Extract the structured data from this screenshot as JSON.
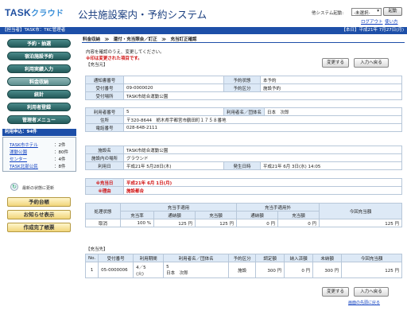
{
  "header": {
    "logo_text": "TASK",
    "logo_sub": "クラウド",
    "app_title": "公共施設案内・予約システム",
    "sys_label": "他システム起動:",
    "sys_select_value": "-未選択-",
    "start_button": "起動",
    "logout_link": "ログアウト",
    "help_link": "使い方"
  },
  "topbar": {
    "left": "【担当者】TASK市：TKC管理者",
    "right": "【本日】平成21年 7月27日(月)"
  },
  "sidebar": {
    "nav": [
      {
        "label": "予約・抽選"
      },
      {
        "label": "宿泊施設予約"
      },
      {
        "label": "利用実績入力"
      },
      {
        "label": "料金収納"
      },
      {
        "label": "統計"
      },
      {
        "label": "利用者登録"
      },
      {
        "label": "管理者メニュー"
      }
    ],
    "box_title": "利用申込：94件",
    "box_rows": [
      {
        "name": "TASK市ホテル",
        "count": "：2件"
      },
      {
        "name": "運動公園",
        "count": "：80件"
      },
      {
        "name": "センター",
        "count": "：4件"
      },
      {
        "name": "TASK北部公民",
        "count": "：8件"
      }
    ],
    "refresh_text": "最新の状態に更新",
    "btn_daicho": "予約台帳",
    "btn_oshirase": "お知らせ表示",
    "btn_kanryo": "作成完了帳票"
  },
  "main": {
    "breadcrumb": "料金収納　≫　還付・充当照会／訂正　≫　充当訂正確認",
    "msg1": "内容を確認のうえ、変更してください。",
    "msg2": "※印は変更された項目です。",
    "sec1_head": "【充当元】",
    "btn_change": "変更する",
    "btn_back": "入力へ戻る",
    "receipt": {
      "notice_no_label": "通知書番号",
      "notice_no_value": "",
      "status_label": "予約状態",
      "status_value": "本予約",
      "uketsuke_no_label": "受付番号",
      "uketsuke_no_value": "09-0000020",
      "yoyaku_kubun_label": "予約区分",
      "yoyaku_kubun_value": "施設予約",
      "uketsuke_basho_label": "受付場所",
      "uketsuke_basho_value": "TASK市総合運動公園"
    },
    "user": {
      "user_no_label": "利用者番号",
      "user_no_value": "5",
      "user_name_label": "利用者名／団体名",
      "user_name_value": "日本　次郎",
      "address_label": "住所",
      "address_value": "〒320-8644　栃木県宇都宮市鶴田町１７５８番地",
      "tel_label": "電話番号",
      "tel_value": "028-648-2111"
    },
    "facility": {
      "shisetsu_label": "施設名",
      "shisetsu_value": "TASK市総合運動公園",
      "naiyou_label": "施設内の場所",
      "naiyou_value": "グラウンド",
      "riyoubi_label": "利用日",
      "riyoubi_value": "平成21年 5月28日(木)",
      "hassei_label": "発生日時",
      "hassei_value": "平成21年 6月 3日(水) 14:05"
    },
    "juto": {
      "date_label": "※充当日",
      "date_value": "平成21年 6月 1日(月)",
      "reason_label": "※理由",
      "reason_value": "施設都合"
    },
    "summary": {
      "h_status": "処理状態",
      "h_applied": "充当手適用",
      "h_not_applied": "充当手適用外",
      "h_this_time": "今回充当額",
      "h_rate": "充当率",
      "h_normal": "通納額",
      "h_amount": "充当額",
      "h_normal2": "通納額",
      "h_amount2": "充当額",
      "row": {
        "status": "取消",
        "rate": "100 %",
        "normal": "125 円",
        "amount": "125 円",
        "normal2": "0 円",
        "amount2": "0 円",
        "this_time": "125 円"
      }
    },
    "sec2_head": "【充当先】",
    "dest": {
      "headers": [
        "No.",
        "受付番号",
        "利用期間",
        "利用者名／団体名",
        "予約区分",
        "調定額",
        "納入済額",
        "未納額",
        "今回充当額"
      ],
      "rows": [
        {
          "no": "1",
          "uketsuke": "05-0000006",
          "period_1": "4／5",
          "period_2": "(火)",
          "user_1": "5",
          "user_2": "日本　次郎",
          "kubun": "施設",
          "chotei": "300 円",
          "nounyu": "0 円",
          "minou": "300 円",
          "konkai": "125 円"
        }
      ]
    },
    "top_link": "画面の先頭に戻る"
  }
}
